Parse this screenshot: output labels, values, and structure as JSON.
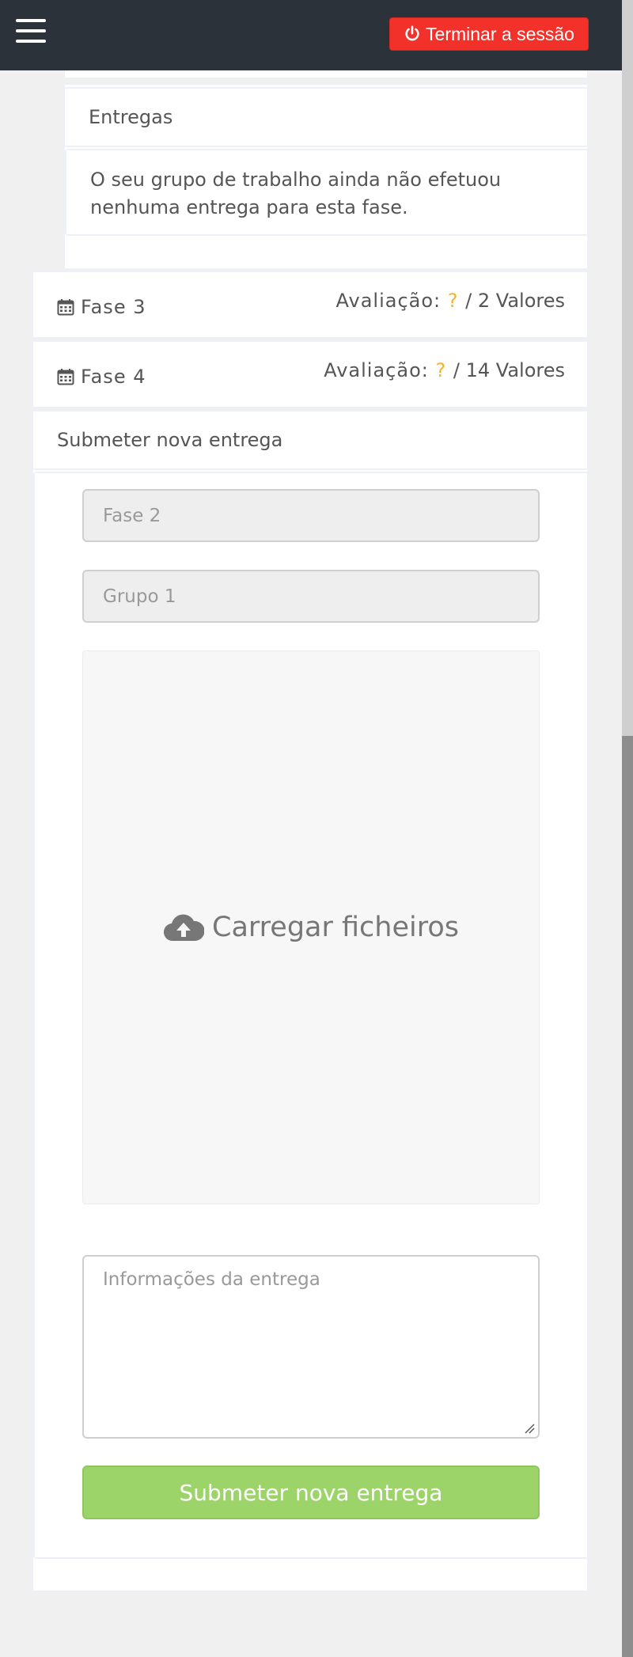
{
  "header": {
    "menu_icon": "hamburger-icon",
    "logout_icon": "power-icon",
    "logout_label": "Terminar a sessão",
    "logout_color": "#f2312a"
  },
  "deliveries": {
    "heading": "Entregas",
    "empty_message": "O seu grupo de trabalho ainda não efetuou nenhuma entrega para esta fase."
  },
  "phases": [
    {
      "icon": "calendar-icon",
      "title": "Fase 3",
      "eval_label": "Avaliação:",
      "eval_score": "?",
      "eval_total": "/ 2 Valores"
    },
    {
      "icon": "calendar-icon",
      "title": "Fase 4",
      "eval_label": "Avaliação:",
      "eval_score": "?",
      "eval_total": "/ 14 Valores"
    }
  ],
  "submit_section": {
    "heading": "Submeter nova entrega",
    "phase_field": "Fase 2",
    "group_field": "Grupo 1",
    "upload_icon": "cloud-upload-icon",
    "upload_label": "Carregar ficheiros",
    "info_placeholder": "Informações da entrega",
    "submit_label": "Submeter nova entrega",
    "submit_color": "#9dd46a"
  }
}
